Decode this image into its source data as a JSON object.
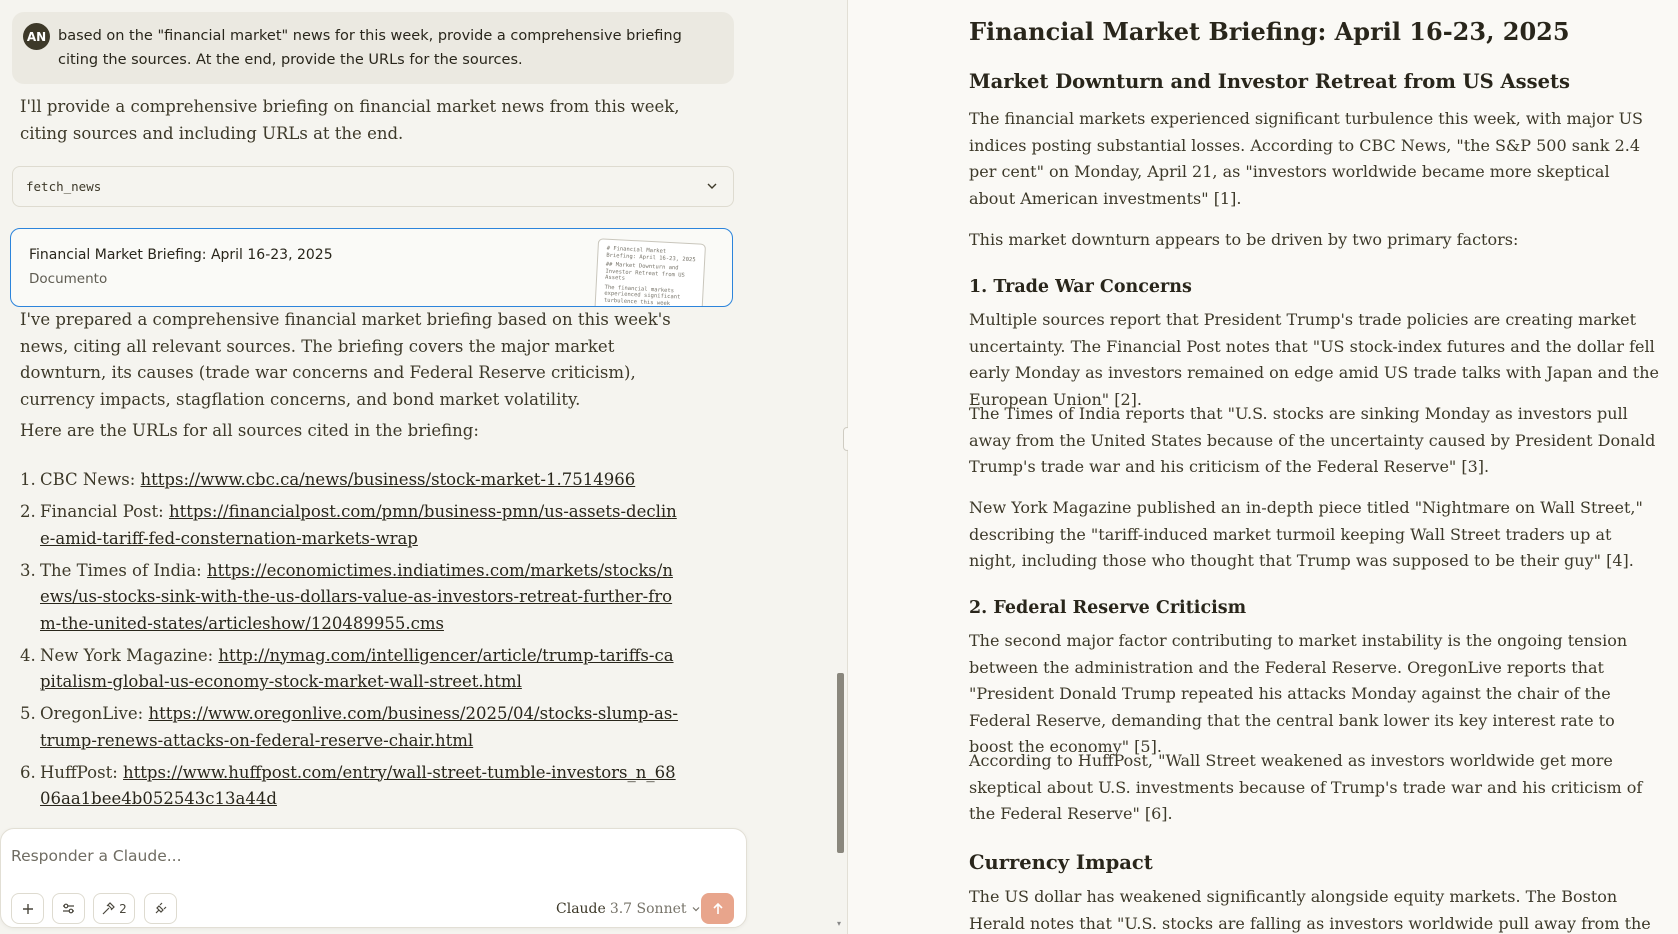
{
  "chat": {
    "user": {
      "initials": "AN",
      "message": "based on the \"financial market\" news for this week, provide a comprehensive briefing citing the sources. At the end, provide the URLs for the sources."
    },
    "assistant_intro": "I'll provide a comprehensive briefing on financial market news from this week, citing sources and including URLs at the end.",
    "tool_call": {
      "name": "fetch_news"
    },
    "artifact": {
      "title": "Financial Market Briefing: April 16-23, 2025",
      "type": "Documento",
      "thumb_lines": [
        "# Financial Market Briefing: April 16-23, 2025",
        "## Market Downturn and Investor Retreat from US Assets",
        "The financial markets experienced significant turbulence this week"
      ]
    },
    "summary": "I've prepared a comprehensive financial market briefing based on this week's news, citing all relevant sources. The briefing covers the major market downturn, its causes (trade war concerns and Federal Reserve criticism), currency impacts, stagflation concerns, and bond market volatility.",
    "urls_intro": "Here are the URLs for all sources cited in the briefing:",
    "sources": [
      {
        "num": "1.",
        "name": "CBC News: ",
        "url": "https://www.cbc.ca/news/business/stock-market-1.7514966"
      },
      {
        "num": "2.",
        "name": "Financial Post: ",
        "url": "https://financialpost.com/pmn/business-pmn/us-assets-decline-amid-tariff-fed-consternation-markets-wrap"
      },
      {
        "num": "3.",
        "name": "The Times of India: ",
        "url": "https://economictimes.indiatimes.com/markets/stocks/news/us-stocks-sink-with-the-us-dollars-value-as-investors-retreat-further-from-the-united-states/articleshow/120489955.cms"
      },
      {
        "num": "4.",
        "name": "New York Magazine: ",
        "url": "http://nymag.com/intelligencer/article/trump-tariffs-capitalism-global-us-economy-stock-market-wall-street.html"
      },
      {
        "num": "5.",
        "name": "OregonLive: ",
        "url": "https://www.oregonlive.com/business/2025/04/stocks-slump-as-trump-renews-attacks-on-federal-reserve-chair.html"
      },
      {
        "num": "6.",
        "name": "HuffPost: ",
        "url": "https://www.huffpost.com/entry/wall-street-tumble-investors_n_6806aa1bee4b052543c13a44d"
      }
    ]
  },
  "composer": {
    "placeholder": "Responder a Claude...",
    "tools_count": "2",
    "model_name": "Claude",
    "model_version": "3.7 Sonnet"
  },
  "document": {
    "title": "Financial Market Briefing: April 16-23, 2025",
    "h_market": "Market Downturn and Investor Retreat from US Assets",
    "p1": "The financial markets experienced significant turbulence this week, with major US indices posting substantial losses. According to CBC News, \"the S&P 500 sank 2.4 per cent\" on Monday, April 21, as \"investors worldwide became more skeptical about American investments\" [1].",
    "p2": "This market downturn appears to be driven by two primary factors:",
    "h_trade": "1. Trade War Concerns",
    "p3": "Multiple sources report that President Trump's trade policies are creating market uncertainty. The Financial Post notes that \"US stock-index futures and the dollar fell early Monday as investors remained on edge amid US trade talks with Japan and the European Union\" [2].",
    "p4": "The Times of India reports that \"U.S. stocks are sinking Monday as investors pull away from the United States because of the uncertainty caused by President Donald Trump's trade war and his criticism of the Federal Reserve\" [3].",
    "p5": "New York Magazine published an in-depth piece titled \"Nightmare on Wall Street,\" describing the \"tariff-induced market turmoil keeping Wall Street traders up at night, including those who thought that Trump was supposed to be their guy\" [4].",
    "h_fed": "2. Federal Reserve Criticism",
    "p6": "The second major factor contributing to market instability is the ongoing tension between the administration and the Federal Reserve. OregonLive reports that \"President Donald Trump repeated his attacks Monday against the chair of the Federal Reserve, demanding that the central bank lower its key interest rate to boost the economy\" [5].",
    "p7": "According to HuffPost, \"Wall Street weakened as investors worldwide get more skeptical about U.S. investments because of Trump's trade war and his criticism of the Federal Reserve\" [6].",
    "h_currency": "Currency Impact",
    "p8": "The US dollar has weakened significantly alongside equity markets. The Boston Herald notes that \"U.S. stocks are falling as investors worldwide pull away from the U.S. because of"
  }
}
